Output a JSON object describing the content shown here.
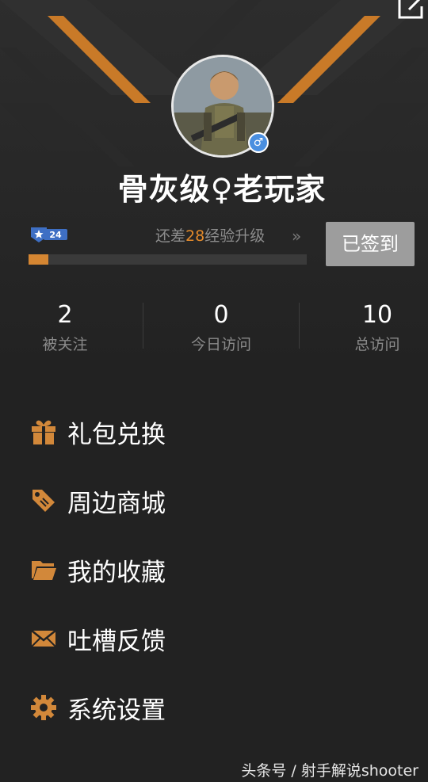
{
  "profile": {
    "username": "骨灰级♀老玩家",
    "gender_symbol": "♂",
    "level": "24",
    "exp_prefix": "还差",
    "exp_remaining": "28",
    "exp_suffix": "经验升级",
    "exp_chevron": "»",
    "exp_progress": 0.07,
    "signin_label": "已签到"
  },
  "stats": [
    {
      "value": "2",
      "label": "被关注"
    },
    {
      "value": "0",
      "label": "今日访问"
    },
    {
      "value": "10",
      "label": "总访问"
    }
  ],
  "menu": [
    {
      "label": "礼包兑换",
      "icon": "gift-icon"
    },
    {
      "label": "周边商城",
      "icon": "tag-icon"
    },
    {
      "label": "我的收藏",
      "icon": "folder-icon"
    },
    {
      "label": "吐槽反馈",
      "icon": "mail-icon"
    },
    {
      "label": "系统设置",
      "icon": "gear-icon"
    }
  ],
  "watermark": "头条号 / 射手解说shooter",
  "colors": {
    "accent": "#e48b2b",
    "background": "#222222",
    "signin_button": "#9d9d9d",
    "gender_badge": "#4a8fe0"
  }
}
